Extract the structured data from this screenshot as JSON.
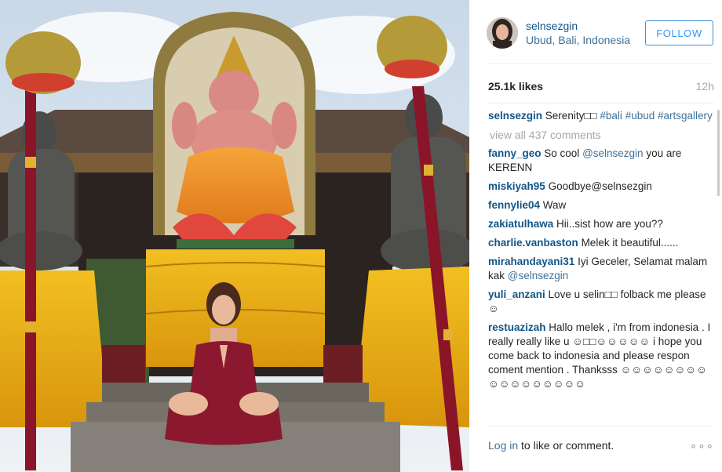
{
  "post": {
    "username": "selnsezgin",
    "location": "Ubud, Bali, Indonesia",
    "follow_label": "FOLLOW",
    "likes": "25.1k likes",
    "time_ago": "12h"
  },
  "caption": {
    "user": "selnsezgin",
    "text_prefix": "Serenity□□ ",
    "tags": [
      "#bali",
      "#ubud",
      "#artsgallery"
    ]
  },
  "view_all_label": "view all 437 comments",
  "comments": [
    {
      "user": "fanny_geo",
      "text": "So cool ",
      "mention": "@selnsezgin",
      "text_after": " you are KERENN"
    },
    {
      "user": "miskiyah95",
      "text": "Goodbye@selnsezgin",
      "mention": "",
      "text_after": ""
    },
    {
      "user": "fennylie04",
      "text": "Waw",
      "mention": "",
      "text_after": ""
    },
    {
      "user": "zakiatulhawa",
      "text": "Hii..sist how are you??",
      "mention": "",
      "text_after": ""
    },
    {
      "user": "charlie.vanbaston",
      "text": "Melek it beautiful......",
      "mention": "",
      "text_after": ""
    },
    {
      "user": "mirahandayani31",
      "text": "Iyi Geceler, Selamat malam kak ",
      "mention": "@selnsezgin",
      "text_after": ""
    },
    {
      "user": "yuli_anzani",
      "text": "Love u selin□□ folback me please☺",
      "mention": "",
      "text_after": ""
    },
    {
      "user": "restuazizah",
      "text": "Hallo melek , i'm from indonesia . I really really like u ☺□□☺☺☺☺☺ i hope you come back to indonesia and please respon coment mention . Thanksss ☺☺☺☺☺☺☺☺☺☺☺☺☺☺☺☺☺",
      "mention": "",
      "text_after": ""
    }
  ],
  "footer": {
    "login_label": "Log in",
    "rest_label": " to like or comment.",
    "more_label": "∘∘∘"
  },
  "photo": {
    "description_icon": "ganesha-temple-photo"
  }
}
